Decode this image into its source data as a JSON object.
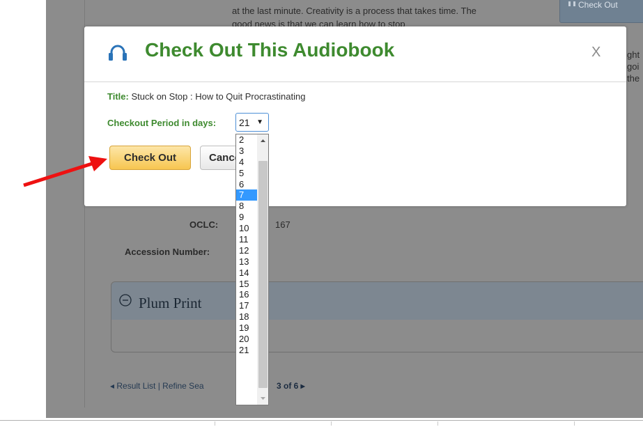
{
  "background_page": {
    "description_lines": [
      "at the last minute. Creativity is a process that takes time. The",
      "good news is that we can learn how to stop"
    ],
    "right_fragments": [
      "ght",
      "goi",
      "the"
    ],
    "checkout_button_label": "Check Out",
    "oclc_label": "OCLC:",
    "oclc_value_fragment": "167",
    "accession_label": "Accession Number:",
    "plum_print_title": "Plum Print",
    "nav_left": "◂ Result List | Refine Sea",
    "nav_right": "3 of 6 ▸"
  },
  "modal": {
    "title": "Check Out This Audiobook",
    "close_label": "X",
    "title_label": "Title:",
    "title_value": "Stuck on Stop : How to Quit Procrastinating",
    "period_label": "Checkout Period in days:",
    "period_selected": "21",
    "checkout_button": "Check Out",
    "cancel_button": "Cancel"
  },
  "dropdown": {
    "options": [
      "2",
      "3",
      "4",
      "5",
      "6",
      "7",
      "8",
      "9",
      "10",
      "11",
      "12",
      "13",
      "14",
      "15",
      "16",
      "17",
      "18",
      "19",
      "20",
      "21"
    ],
    "highlighted": "7"
  },
  "colors": {
    "accent_green": "#3e8a2f",
    "highlight_blue": "#3399ff",
    "checkout_yellow": "#f7c650",
    "arrow_red": "#ee1111"
  },
  "icons": [
    "headphones-icon",
    "collapse-circle-icon",
    "chevron-down-icon",
    "red-pointer-arrow"
  ]
}
